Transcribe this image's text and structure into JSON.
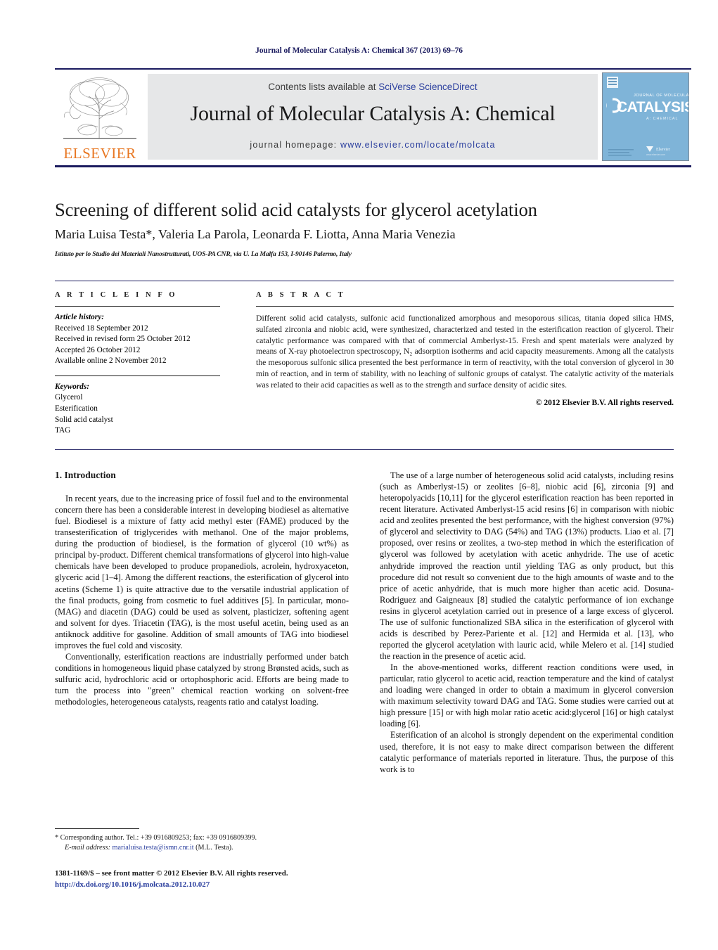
{
  "running_head": "Journal of Molecular Catalysis A: Chemical 367 (2013) 69–76",
  "masthead": {
    "contents_prefix": "Contents lists available at ",
    "contents_link": "SciVerse ScienceDirect",
    "journal_name": "Journal of Molecular Catalysis A: Chemical",
    "homepage_label": "journal homepage:",
    "homepage_url": "www.elsevier.com/locate/molcata",
    "publisher_wordmark": "ELSEVIER",
    "cover_title_line1": "JOURNAL OF MOLECULAR",
    "cover_title_line2": "CATALYSIS",
    "cover_title_line3": "A: CHEMICAL",
    "cover_publisher": "Elsevier",
    "accent_orange": "#E87722",
    "accent_blue": "#2b3f9e",
    "banner_grey": "#e6e7e8",
    "cover_blue": "#7fb4d8"
  },
  "article": {
    "title": "Screening of different solid acid catalysts for glycerol acetylation",
    "authors": "Maria Luisa Testa*, Valeria La Parola, Leonarda F. Liotta, Anna Maria Venezia",
    "affiliation": "Istituto per lo Studio dei Materiali Nanostrutturati, UOS-PA CNR, via U. La Malfa 153, I-90146 Palermo, Italy"
  },
  "info": {
    "heading": "A R T I C L E   I N F O",
    "history_label": "Article history:",
    "history": [
      "Received 18 September 2012",
      "Received in revised form 25 October 2012",
      "Accepted 26 October 2012",
      "Available online 2 November 2012"
    ],
    "keywords_label": "Keywords:",
    "keywords": [
      "Glycerol",
      "Esterification",
      "Solid acid catalyst",
      "TAG"
    ]
  },
  "abstract": {
    "heading": "A B S T R A C T",
    "text": "Different solid acid catalysts, sulfonic acid functionalized amorphous and mesoporous silicas, titania doped silica HMS, sulfated zirconia and niobic acid, were synthesized, characterized and tested in the esterification reaction of glycerol. Their catalytic performance was compared with that of commercial Amberlyst-15. Fresh and spent materials were analyzed by means of X-ray photoelectron spectroscopy, N₂ adsorption isotherms and acid capacity measurements. Among all the catalysts the mesoporous sulfonic silica presented the best performance in term of reactivity, with the total conversion of glycerol in 30 min of reaction, and in term of stability, with no leaching of sulfonic groups of catalyst. The catalytic activity of the materials was related to their acid capacities as well as to the strength and surface density of acidic sites.",
    "copyright": "© 2012 Elsevier B.V. All rights reserved."
  },
  "body": {
    "section_number_title": "1.  Introduction",
    "left_paragraphs": [
      "In recent years, due to the increasing price of fossil fuel and to the environmental concern there has been a considerable interest in developing biodiesel as alternative fuel. Biodiesel is a mixture of fatty acid methyl ester (FAME) produced by the transesterification of triglycerides with methanol. One of the major problems, during the production of biodiesel, is the formation of glycerol (10 wt%) as principal by-product. Different chemical transformations of glycerol into high-value chemicals have been developed to produce propanediols, acrolein, hydroxyaceton, glyceric acid [1–4]. Among the different reactions, the esterification of glycerol into acetins (Scheme 1) is quite attractive due to the versatile industrial application of the final products, going from cosmetic to fuel additives [5]. In particular, mono- (MAG) and diacetin (DAG) could be used as solvent, plasticizer, softening agent and solvent for dyes. Triacetin (TAG), is the most useful acetin, being used as an antiknock additive for gasoline. Addition of small amounts of TAG into biodiesel improves the fuel cold and viscosity.",
      "Conventionally, esterification reactions are industrially performed under batch conditions in homogeneous liquid phase catalyzed by strong Brønsted acids, such as sulfuric acid, hydrochloric acid or ortophosphoric acid. Efforts are being made to turn the process into \"green\" chemical reaction working on solvent-free methodologies, heterogeneous catalysts, reagents ratio and catalyst loading."
    ],
    "right_paragraphs": [
      "The use of a large number of heterogeneous solid acid catalysts, including resins (such as Amberlyst-15) or zeolites [6–8], niobic acid [6], zirconia [9] and heteropolyacids [10,11] for the glycerol esterification reaction has been reported in recent literature. Activated Amberlyst-15 acid resins [6] in comparison with niobic acid and zeolites presented the best performance, with the highest conversion (97%) of glycerol and selectivity to DAG (54%) and TAG (13%) products. Liao et al. [7] proposed, over resins or zeolites, a two-step method in which the esterification of glycerol was followed by acetylation with acetic anhydride. The use of acetic anhydride improved the reaction until yielding TAG as only product, but this procedure did not result so convenient due to the high amounts of waste and to the price of acetic anhydride, that is much more higher than acetic acid. Dosuna-Rodriguez and Gaigneaux [8] studied the catalytic performance of ion exchange resins in glycerol acetylation carried out in presence of a large excess of glycerol. The use of sulfonic functionalized SBA silica in the esterification of glycerol with acids is described by Perez-Pariente et al. [12] and Hermida et al. [13], who reported the glycerol acetylation with lauric acid, while Melero et al. [14] studied the reaction in the presence of acetic acid.",
      "In the above-mentioned works, different reaction conditions were used, in particular, ratio glycerol to acetic acid, reaction temperature and the kind of catalyst and loading were changed in order to obtain a maximum in glycerol conversion with maximum selectivity toward DAG and TAG. Some studies were carried out at high pressure [15] or with high molar ratio acetic acid:glycerol [16] or high catalyst loading [6].",
      "Esterification of an alcohol is strongly dependent on the experimental condition used, therefore, it is not easy to make direct comparison between the different catalytic performance of materials reported in literature. Thus, the purpose of this work is to"
    ]
  },
  "footnote": {
    "corresponding": "* Corresponding author. Tel.: +39 0916809253; fax: +39 0916809399.",
    "email_label": "E-mail address:",
    "email": "marialuisa.testa@ismn.cnr.it",
    "email_suffix": "(M.L. Testa).",
    "frontmatter": "1381-1169/$ – see front matter © 2012 Elsevier B.V. All rights reserved.",
    "doi": "http://dx.doi.org/10.1016/j.molcata.2012.10.027"
  }
}
